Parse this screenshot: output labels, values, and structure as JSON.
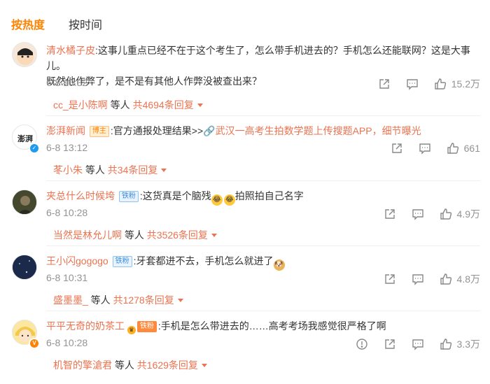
{
  "tabs": [
    {
      "label": "按热度",
      "active": true
    },
    {
      "label": "按时间",
      "active": false
    }
  ],
  "comments": [
    {
      "user": "清水橘子皮",
      "text_line1": ":这事儿重点已经不在于这个考生了，怎么带手机进去的？手机怎么还能联网？这是大事儿。",
      "text_line2": "既然他作弊了，是不是有其他人作弊没被查出来？",
      "time": "6-8 10:32",
      "likes": "15.2万",
      "reply_user": "cc_是小陈啊",
      "reply_mid": " 等人 ",
      "reply_count": "共4694条回复"
    },
    {
      "user": "澎湃新闻",
      "badge": "博主",
      "text": ":官方通报处理结果>>",
      "link_icon": "link-icon",
      "link": "武汉一高考生拍数学题上传搜题APP，细节曝光",
      "time": "6-8 13:12",
      "likes": "661",
      "reply_user": "苳小朱",
      "reply_mid": " 等人 ",
      "reply_count": "共34条回复"
    },
    {
      "user": "夹总什么时候垮",
      "badge": "铁粉",
      "text_a": ":这货真是个脑残",
      "text_b": "拍照拍自己名字",
      "time": "6-8 10:28",
      "likes": "4.9万",
      "reply_user": "当然是林允儿啊",
      "reply_mid": " 等人 ",
      "reply_count": "共3526条回复"
    },
    {
      "user": "王小闪gogogo",
      "badge": "铁粉",
      "text": ":牙套都进不去，手机怎么就进了",
      "time": "6-8 10:31",
      "likes": "4.8万",
      "reply_user": "盛墨墨_",
      "reply_mid": " 等人 ",
      "reply_count": "共1278条回复"
    },
    {
      "user": "平平无奇的奶茶工",
      "badge": "铁粉",
      "text": ":手机是怎么带进去的……高考考场我感觉很严格了啊",
      "time": "6-8 10:28",
      "likes": "3.3万",
      "reply_user": "机智的擎滄君",
      "reply_mid": " 等人 ",
      "reply_count": "共1629条回复"
    }
  ],
  "colors": {
    "accent": "#ff8200",
    "username": "#eb7350",
    "meta": "#939393"
  }
}
